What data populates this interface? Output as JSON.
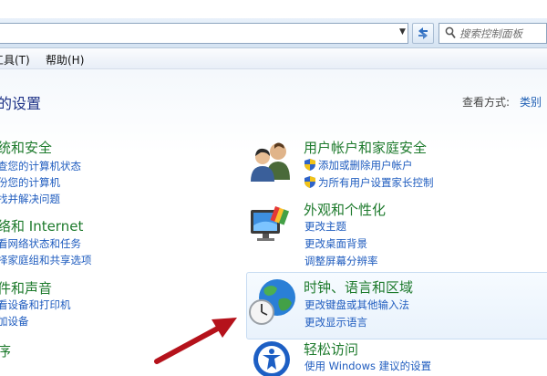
{
  "search": {
    "placeholder": "搜索控制面板"
  },
  "menu": {
    "tools": "工具(T)",
    "help": "帮助(H)"
  },
  "page": {
    "title": "的设置",
    "view_label": "查看方式:",
    "view_value": "类别"
  },
  "left_categories": [
    {
      "title": "统和安全",
      "links": [
        "查您的计算机状态",
        "份您的计算机",
        "找并解决问题"
      ]
    },
    {
      "title": "络和 Internet",
      "links": [
        "看网络状态和任务",
        "择家庭组和共享选项"
      ]
    },
    {
      "title": "件和声音",
      "links": [
        "看设备和打印机",
        "加设备"
      ]
    },
    {
      "title": "序",
      "links": []
    }
  ],
  "right_categories": [
    {
      "title": "用户帐户和家庭安全",
      "icon": "users-icon",
      "links": [
        {
          "text": "添加或删除用户帐户",
          "shield": true
        },
        {
          "text": "为所有用户设置家长控制",
          "shield": true
        }
      ]
    },
    {
      "title": "外观和个性化",
      "icon": "monitor-palette-icon",
      "links": [
        {
          "text": "更改主题",
          "shield": false
        },
        {
          "text": "更改桌面背景",
          "shield": false
        },
        {
          "text": "调整屏幕分辨率",
          "shield": false
        }
      ]
    },
    {
      "title": "时钟、语言和区域",
      "icon": "globe-clock-icon",
      "links": [
        {
          "text": "更改键盘或其他输入法",
          "shield": false
        },
        {
          "text": "更改显示语言",
          "shield": false
        }
      ]
    },
    {
      "title": "轻松访问",
      "icon": "ease-of-access-icon",
      "links": [
        {
          "text": "使用 Windows 建议的设置",
          "shield": false
        }
      ]
    }
  ],
  "colors": {
    "link": "#1f5cbf",
    "category_title": "#1d7a2c",
    "annotation_arrow": "#b5121b"
  }
}
